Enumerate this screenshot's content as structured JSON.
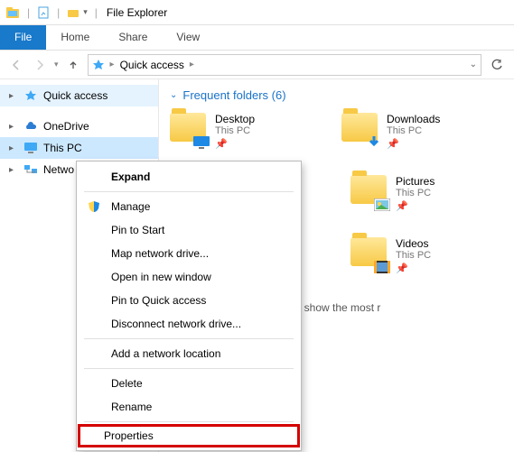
{
  "titlebar": {
    "app_title": "File Explorer"
  },
  "ribbon": {
    "file": "File",
    "home": "Home",
    "share": "Share",
    "view": "View"
  },
  "address": {
    "root": "Quick access"
  },
  "tree": {
    "quick_access": "Quick access",
    "onedrive": "OneDrive",
    "this_pc": "This PC",
    "network": "Netwo"
  },
  "section": {
    "title": "Frequent folders (6)"
  },
  "folders": [
    {
      "name": "Desktop",
      "sub": "This PC"
    },
    {
      "name": "Downloads",
      "sub": "This PC"
    },
    {
      "name": "Pictures",
      "sub": "This PC"
    },
    {
      "name": "Videos",
      "sub": "This PC"
    }
  ],
  "recent_note": "'ve opened some files, we'll show the most r",
  "ctx": {
    "expand": "Expand",
    "manage": "Manage",
    "pin_start": "Pin to Start",
    "map_drive": "Map network drive...",
    "open_new": "Open in new window",
    "pin_quick": "Pin to Quick access",
    "disconnect": "Disconnect network drive...",
    "add_loc": "Add a network location",
    "delete": "Delete",
    "rename": "Rename",
    "properties": "Properties"
  }
}
